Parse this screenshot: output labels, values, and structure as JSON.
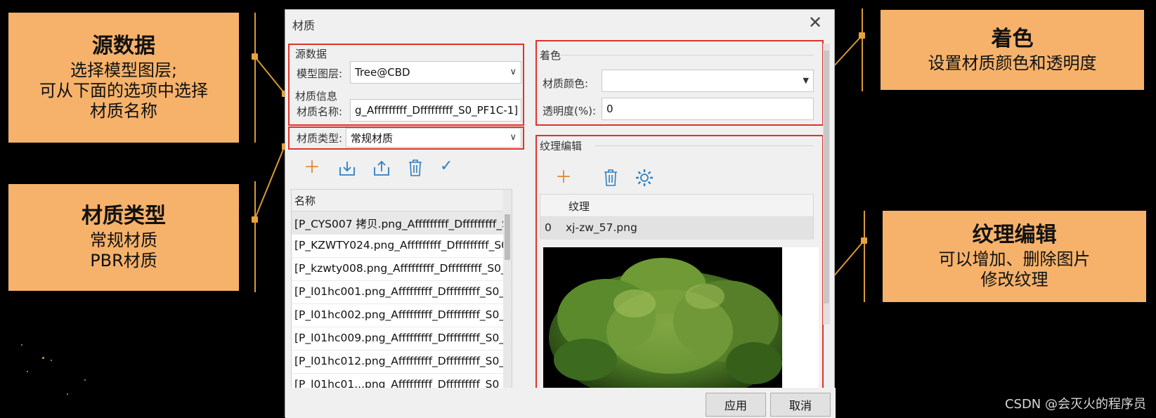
{
  "callouts": {
    "source": {
      "title": "源数据",
      "lines": [
        "选择模型图层;",
        "可从下面的选项中选择",
        "材质名称"
      ]
    },
    "material_type": {
      "title": "材质类型",
      "lines": [
        "常规材质",
        "PBR材质"
      ]
    },
    "coloring": {
      "title": "着色",
      "lines": [
        "设置材质颜色和透明度"
      ]
    },
    "texture_edit": {
      "title": "纹理编辑",
      "lines": [
        "可以增加、删除图片",
        "修改纹理"
      ]
    }
  },
  "dialog": {
    "title": "材质",
    "source_group": "源数据",
    "model_layer_label": "模型图层:",
    "model_layer_value": "Tree@CBD",
    "material_info_group": "材质信息",
    "material_name_label": "材质名称:",
    "material_name_value": "g_Afffffffff_Dfffffffff_S0_PF1C-1]",
    "material_type_label": "材质类型:",
    "material_type_value": "常规材质",
    "list_header": "名称",
    "list_items": [
      "[P_CYS007 拷贝.png_Afffffffff_Dfffffffff_S...",
      "[P_KZWTY024.png_Afffffffff_Dfffffffff_S0...",
      "[P_kzwty008.png_Afffffffff_Dfffffffff_S0_...",
      "[P_l01hc001.png_Afffffffff_Dfffffffff_S0_...",
      "[P_l01hc002.png_Afffffffff_Dfffffffff_S0_...",
      "[P_l01hc009.png_Afffffffff_Dfffffffff_S0_...",
      "[P_l01hc012.png_Afffffffff_Dfffffffff_S0_...",
      "[P_l01hc01...png_Afffffffff_Dfffffffff_S0_..."
    ],
    "coloring_group": "着色",
    "material_color_label": "材质颜色:",
    "opacity_label": "透明度(%):",
    "opacity_value": "0",
    "texture_group": "纹理编辑",
    "texture_header": "纹理",
    "texture_row_index": "0",
    "texture_row_name": "xj-zw_57.png",
    "apply_button": "应用",
    "cancel_button": "取消"
  },
  "watermark": "CSDN @会灭火的程序员",
  "colors": {
    "callout": "#f6b26b",
    "highlight": "#e0322a",
    "connector": "#d89a36",
    "accent_icon": "#d9822b",
    "blue_icon": "#2d7fc1"
  }
}
